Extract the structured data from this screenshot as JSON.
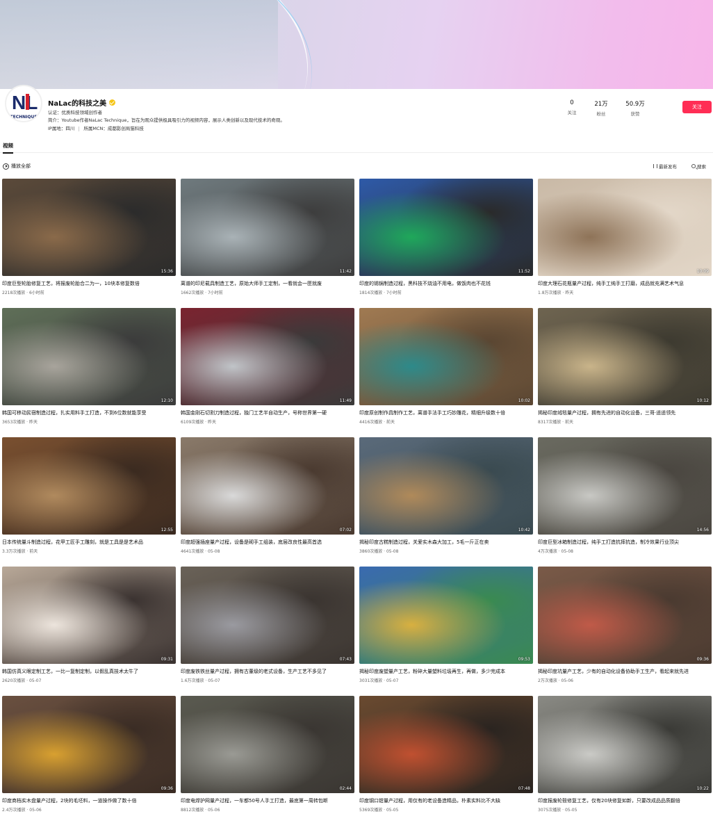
{
  "profile": {
    "name": "NaLac的科技之美",
    "avatar_text": "NL",
    "avatar_subtext": "TECHNIQUE",
    "auth": "认证：优质科技领域创作者",
    "bio": "简介：Youtube作者NaLac Technique，旨在为观众提供极具吸引力的视频内容，展示人类创新以及现代技术的奇观。",
    "ip": "IP属地：四川",
    "mcn": "所属MCN：成都影创局猫科技"
  },
  "stats": [
    {
      "num": "0",
      "label": "关注"
    },
    {
      "num": "21万",
      "label": "粉丝"
    },
    {
      "num": "50.9万",
      "label": "获赞"
    }
  ],
  "follow_label": "关注",
  "tabs": {
    "video": "视频"
  },
  "toolbar": {
    "play_all": "播放全部",
    "latest": "最新发布",
    "search": "搜索"
  },
  "videos": [
    {
      "title": "印度巨型轮胎修复工艺，将报废轮胎合二为一，10块本修复数倍",
      "meta": "2218次播放 · 6小时前",
      "dur": "15:36"
    },
    {
      "title": "离谱的印尼载具制造工艺，原始大师手工定制，一看就会一匣就废",
      "meta": "1662次播放 · 7小时前",
      "dur": "11:42"
    },
    {
      "title": "印度的锡锅制造过程，黑科技不烧油不用电，做饭肉也不花钱",
      "meta": "1814次播放 · 7小时前",
      "dur": "11:52"
    },
    {
      "title": "印度大理石花瓶量产过程，纯手工纯手工打磨，成品就充满艺术气息",
      "meta": "1.8万次播放 · 昨天",
      "dur": "10:09"
    },
    {
      "title": "韩国可移动民宿制造过程，扎实用料手工打造，不到6位数就能享受",
      "meta": "3653次播放 · 昨天",
      "dur": "12:10"
    },
    {
      "title": "韩国金刚石切割刀制造过程，独门工艺半自动生产，号称世界第一硬",
      "meta": "6109次播放 · 昨天",
      "dur": "11:49"
    },
    {
      "title": "印度原创制作具制作工艺，离谱手法手工巧妙雕花，精细升级数十倍",
      "meta": "4416次播放 · 前天",
      "dur": "10:02"
    },
    {
      "title": "揭秘印度绒毯量产过程，拥有先进的自动化设备，三哥·遥遥领先",
      "meta": "8317次播放 · 前天",
      "dur": "10:12"
    },
    {
      "title": "日本传统量斗制造过程，花甲工匠手工雕刻，就是工具是是艺术品",
      "meta": "3.3万次播放 · 前天",
      "dur": "12:55"
    },
    {
      "title": "印度超强插座量产过程，设备是砌手工组装，底层改良性最高首选",
      "meta": "4641次播放 · 05-08",
      "dur": "07:02"
    },
    {
      "title": "揭秘印度古糕制造过程，关爱实木森大加工，5毛一斤正在卖",
      "meta": "3860次播放 · 05-08",
      "dur": "10:42"
    },
    {
      "title": "印度巨型冰箱制造过程，纯手工打造抗摔抗造，制冷效果行业顶尖",
      "meta": "4万次播放 · 05-08",
      "dur": "14:56"
    },
    {
      "title": "韩国仿真义眼定制工艺，一比一复制定制，以假乱真技术太牛了",
      "meta": "2620次播放 · 05-07",
      "dur": "09:31"
    },
    {
      "title": "印度废铁铁丝量产过程，拥有古董级的老式设备，生产工艺不多见了",
      "meta": "1.6万次播放 · 05-07",
      "dur": "07:43"
    },
    {
      "title": "揭秘印度废塑量产工艺，粉碎大量塑料垃圾再生，再做，多少完成本",
      "meta": "3031次播放 · 05-07",
      "dur": "09:53"
    },
    {
      "title": "揭秘印度坑量产工艺，少有的自动化设备协助手工生产，看起来就先进",
      "meta": "2万次播放 · 05-06",
      "dur": "09:36"
    },
    {
      "title": "印度商档实木盘量产过程，2块的毛坯料，一道操作做了数十倍",
      "meta": "2.4万次播放 · 05-06",
      "dur": "09:36"
    },
    {
      "title": "印度电焊护网量产过程，一车都50号人手工打造，最底第一周转包断",
      "meta": "8812次播放 · 05-06",
      "dur": "02:44"
    },
    {
      "title": "印度钢口钳量产过程，用仅有的老设备造精品，朴素实料比不大缺",
      "meta": "5369次播放 · 05-05",
      "dur": "07:48"
    },
    {
      "title": "印度报废轮毂修复工艺，仅有20块修复如新，只要改成品品质翻倍",
      "meta": "3075次播放 · 05-05",
      "dur": "10:22"
    }
  ]
}
